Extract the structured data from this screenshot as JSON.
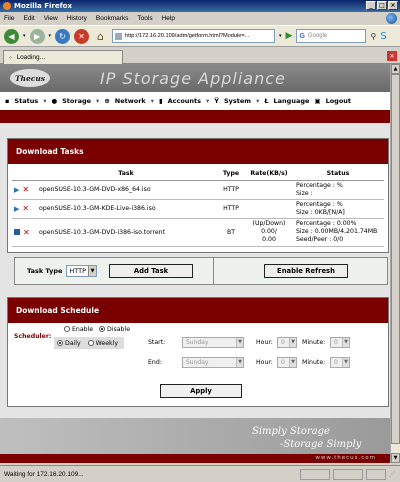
{
  "window": {
    "title": "Mozilla Firefox"
  },
  "menubar": {
    "items": [
      "File",
      "Edit",
      "View",
      "History",
      "Bookmarks",
      "Tools",
      "Help"
    ]
  },
  "navbar": {
    "url": "http://172.16.20.109/adm/getform.html?Module=...",
    "search_placeholder": "Google"
  },
  "tab": {
    "title": "Loading..."
  },
  "header": {
    "logo": "Thecus",
    "title": "IP Storage Appliance"
  },
  "productnav": {
    "items": [
      "Status",
      "Storage",
      "Network",
      "Accounts",
      "System",
      "Language",
      "Logout"
    ]
  },
  "download_tasks": {
    "heading": "Download Tasks",
    "columns": [
      "Task",
      "Type",
      "Rate(KB/s)",
      "Status"
    ],
    "rows": [
      {
        "control": "play",
        "task": "openSUSE-10.3-GM-DVD-x86_64.iso",
        "type": "HTTP",
        "rate": "",
        "status_line1": "Percentage : %",
        "status_line2": "Size :",
        "status_line3": ""
      },
      {
        "control": "play",
        "task": "openSUSE-10.3-GM-KDE-Live-i386.iso",
        "type": "HTTP",
        "rate": "",
        "status_line1": "Percentage : %",
        "status_line2": "Size : 0KB/[N/A]",
        "status_line3": ""
      },
      {
        "control": "stop",
        "task": "openSUSE-10.3-GM-DVD-i386-iso.torrent",
        "type": "BT",
        "rate": "(Up/Down)\n0.00/\n0.00",
        "status_line1": "Percentage : 0.00%",
        "status_line2": "Size : 0.00MB/4,201.74MB",
        "status_line3": "Seed/Peer : 0/0"
      }
    ]
  },
  "add_task": {
    "task_type_label": "Task Type",
    "task_type_value": "HTTP",
    "add_button": "Add Task",
    "refresh_button": "Enable Refresh"
  },
  "schedule": {
    "heading": "Download Schedule",
    "scheduler_label": "Scheduler:",
    "enable_label": "Enable",
    "disable_label": "Disable",
    "daily_label": "Daily",
    "weekly_label": "Weekly",
    "start_label": "Start:",
    "end_label": "End:",
    "day_value": "Sunday",
    "hour_label": "Hour:",
    "minute_label": "Minute:",
    "hour_value": "0",
    "minute_value": "0"
  },
  "apply_button": "Apply",
  "footer": {
    "slogan1": "Simply Storage",
    "slogan2": "-Storage Simply",
    "url": "www.thecus.com"
  },
  "statusbar": {
    "text": "Waiting for 172.16.20.109..."
  }
}
